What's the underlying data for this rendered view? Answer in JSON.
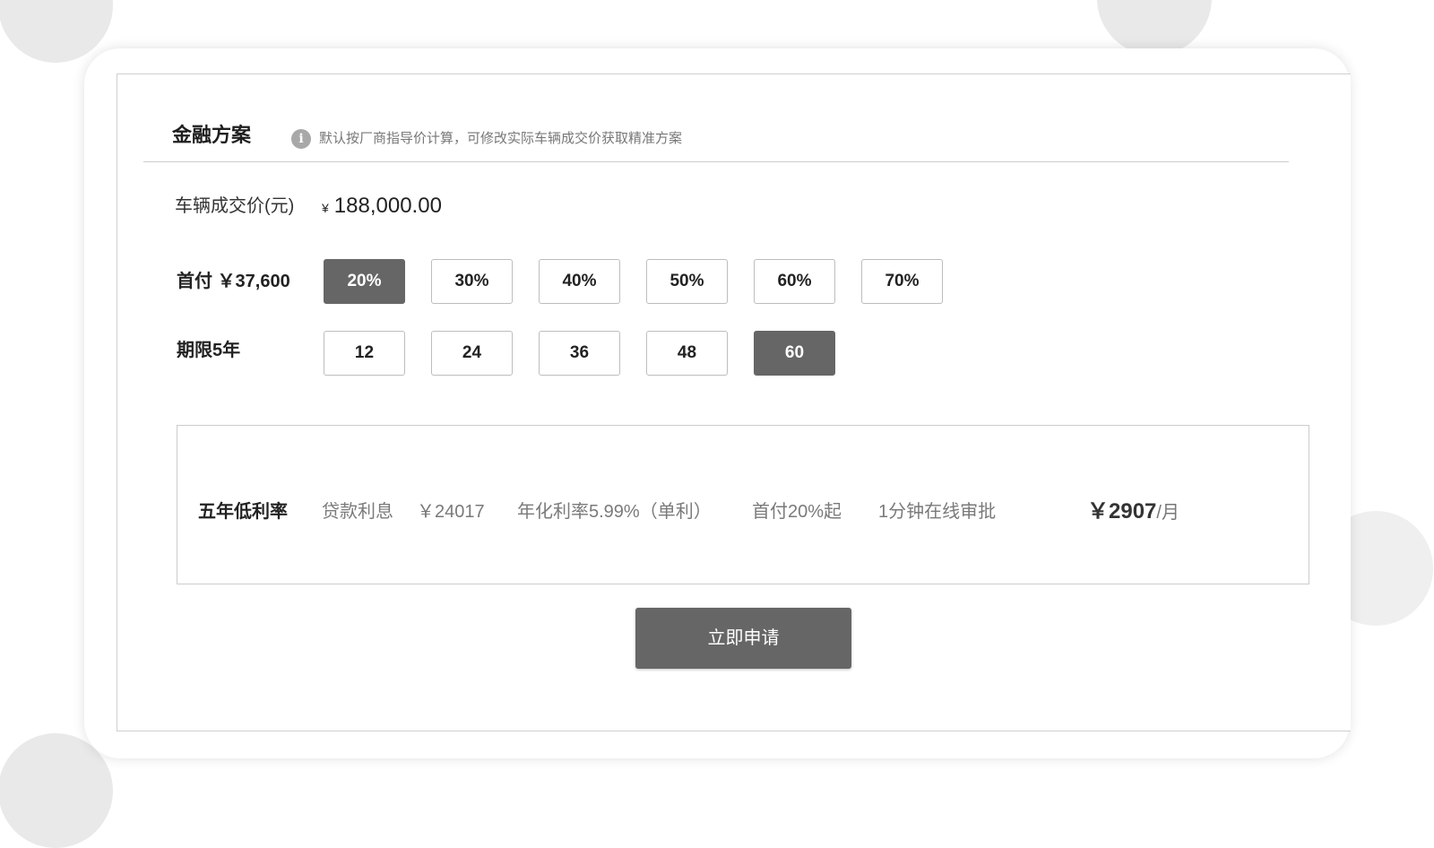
{
  "header": {
    "title": "金融方案",
    "info_icon": "info-icon",
    "hint": "默认按厂商指导价计算，可修改实际车辆成交价获取精准方案"
  },
  "price": {
    "label": "车辆成交价(元)",
    "currency": "¥",
    "value": "188,000.00"
  },
  "down_payment": {
    "label": "首付 ￥37,600",
    "options": [
      "20%",
      "30%",
      "40%",
      "50%",
      "60%",
      "70%"
    ],
    "selected": "20%"
  },
  "term": {
    "label": "期限5年",
    "options": [
      "12",
      "24",
      "36",
      "48",
      "60"
    ],
    "selected": "60"
  },
  "summary": {
    "plan_name": "五年低利率",
    "interest_label": "贷款利息",
    "interest_value": "￥24017",
    "rate": "年化利率5.99%（单利）",
    "down_min": "首付20%起",
    "approval": "1分钟在线审批",
    "monthly_amount": "￥2907",
    "monthly_unit": "/月"
  },
  "apply_button": "立即申请",
  "colors": {
    "selected_bg": "#666666",
    "border": "#bdbdbd",
    "muted_text": "#7a7a7a"
  }
}
